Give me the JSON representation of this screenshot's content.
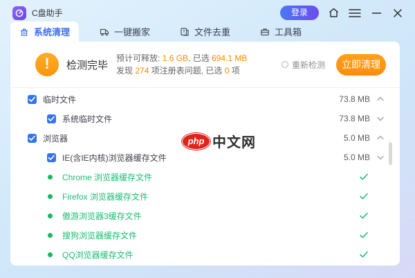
{
  "titlebar": {
    "app_title": "C盘助手",
    "login_label": "登录"
  },
  "tabs": [
    {
      "label": "系统清理",
      "icon": "system-clean-icon",
      "active": true
    },
    {
      "label": "一键搬家",
      "icon": "one-key-move-icon",
      "active": false
    },
    {
      "label": "文件去重",
      "icon": "file-dedupe-icon",
      "active": false
    },
    {
      "label": "工具箱",
      "icon": "toolbox-icon",
      "active": false
    }
  ],
  "summary": {
    "status_title": "检测完毕",
    "line1": [
      {
        "text": "预计可释放: ",
        "highlight": false
      },
      {
        "text": "1.6 GB",
        "highlight": true
      },
      {
        "text": ", 已选 ",
        "highlight": false
      },
      {
        "text": "694.1 MB",
        "highlight": true
      }
    ],
    "line2": [
      {
        "text": "发现 ",
        "highlight": false
      },
      {
        "text": "274",
        "highlight": true
      },
      {
        "text": " 项注册表问题, 已选 ",
        "highlight": false
      },
      {
        "text": "0",
        "highlight": true
      },
      {
        "text": " 项",
        "highlight": false
      }
    ],
    "recheck_label": "重新检测",
    "clean_button_label": "立即清理"
  },
  "list": {
    "rows": [
      {
        "type": "group",
        "label": "临时文件",
        "size": "73.8 MB",
        "chevron": "up",
        "checked": true
      },
      {
        "type": "sub",
        "label": "系统临时文件",
        "size": "73.8 MB",
        "chevron": "down",
        "checked": true
      },
      {
        "type": "group",
        "label": "浏览器",
        "size": "5.0 MB",
        "chevron": "up",
        "checked": true
      },
      {
        "type": "sub",
        "label": "IE(含IE内核)浏览器缓存文件",
        "size": "5.0 MB",
        "chevron": "down",
        "checked": true
      },
      {
        "type": "done",
        "label": "Chrome 浏览器缓存文件"
      },
      {
        "type": "done",
        "label": "Firefox 浏览器缓存文件"
      },
      {
        "type": "done",
        "label": "傲游浏览器3缓存文件"
      },
      {
        "type": "done",
        "label": "搜狗浏览器缓存文件"
      },
      {
        "type": "done",
        "label": "QQ浏览器缓存文件"
      }
    ]
  },
  "watermark": {
    "badge": "php",
    "text": "中文网"
  },
  "colors": {
    "accent_blue": "#3a6ff2",
    "checkbox_blue": "#3473f5",
    "button_orange": "#ff9312",
    "highlight_orange": "#ff8a00",
    "done_green": "#1dbd73"
  }
}
